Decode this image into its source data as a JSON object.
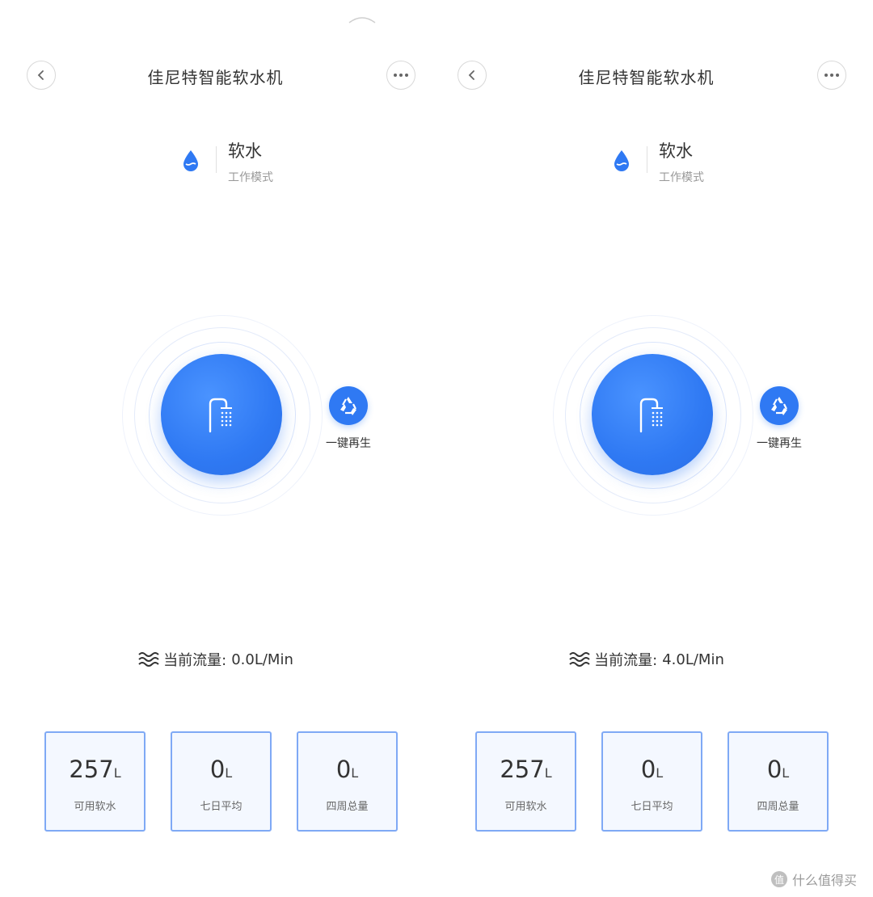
{
  "watermark": {
    "icon": "zhi-logo-icon",
    "text": "什么值得买"
  },
  "accent_color": "#2f79f3",
  "panels": [
    {
      "header": {
        "title": "佳尼特智能软水机",
        "back_icon": "chevron-left-icon",
        "more_icon": "more-dots-icon"
      },
      "mode": {
        "value": "软水",
        "label": "工作模式",
        "icon": "water-drop-icon"
      },
      "main_button": {
        "icon": "shower-icon"
      },
      "regenerate": {
        "label": "一键再生",
        "icon": "recycle-icon"
      },
      "flow": {
        "label": "当前流量:",
        "value": "0.0L/Min",
        "icon": "water-wave-icon"
      },
      "stats": [
        {
          "value": "257",
          "unit": "L",
          "label": "可用软水"
        },
        {
          "value": "0",
          "unit": "L",
          "label": "七日平均"
        },
        {
          "value": "0",
          "unit": "L",
          "label": "四周总量"
        }
      ]
    },
    {
      "header": {
        "title": "佳尼特智能软水机",
        "back_icon": "chevron-left-icon",
        "more_icon": "more-dots-icon"
      },
      "mode": {
        "value": "软水",
        "label": "工作模式",
        "icon": "water-drop-icon"
      },
      "main_button": {
        "icon": "shower-icon"
      },
      "regenerate": {
        "label": "一键再生",
        "icon": "recycle-icon"
      },
      "flow": {
        "label": "当前流量:",
        "value": "4.0L/Min",
        "icon": "water-wave-icon"
      },
      "stats": [
        {
          "value": "257",
          "unit": "L",
          "label": "可用软水"
        },
        {
          "value": "0",
          "unit": "L",
          "label": "七日平均"
        },
        {
          "value": "0",
          "unit": "L",
          "label": "四周总量"
        }
      ]
    }
  ]
}
